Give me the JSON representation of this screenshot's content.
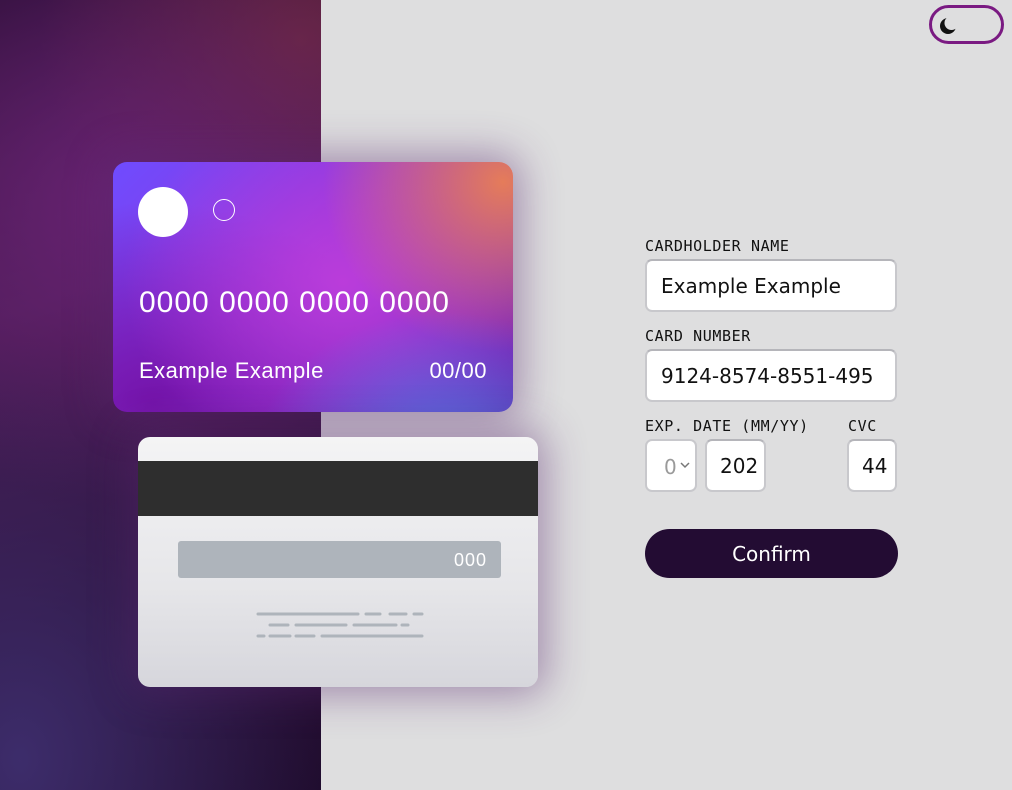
{
  "card_front": {
    "number": "0000 0000 0000 0000",
    "name": "Example Example",
    "expiry": "00/00"
  },
  "card_back": {
    "cvc": "000"
  },
  "theme_toggle": {
    "icon": "moon-icon"
  },
  "form": {
    "cardholder_name": {
      "label": "CARDHOLDER NAME",
      "value": "Example Example"
    },
    "card_number": {
      "label": "CARD NUMBER",
      "value": "9124-8574-8551-495"
    },
    "exp_date": {
      "label": "EXP. DATE (MM/YY)",
      "month_value": "0",
      "year_value": "202"
    },
    "cvc": {
      "label": "CVC",
      "value": "44"
    },
    "confirm_label": "Confirm"
  },
  "colors": {
    "accent": "#7a1a82",
    "button": "#230c33",
    "page_bg": "#dededf"
  }
}
